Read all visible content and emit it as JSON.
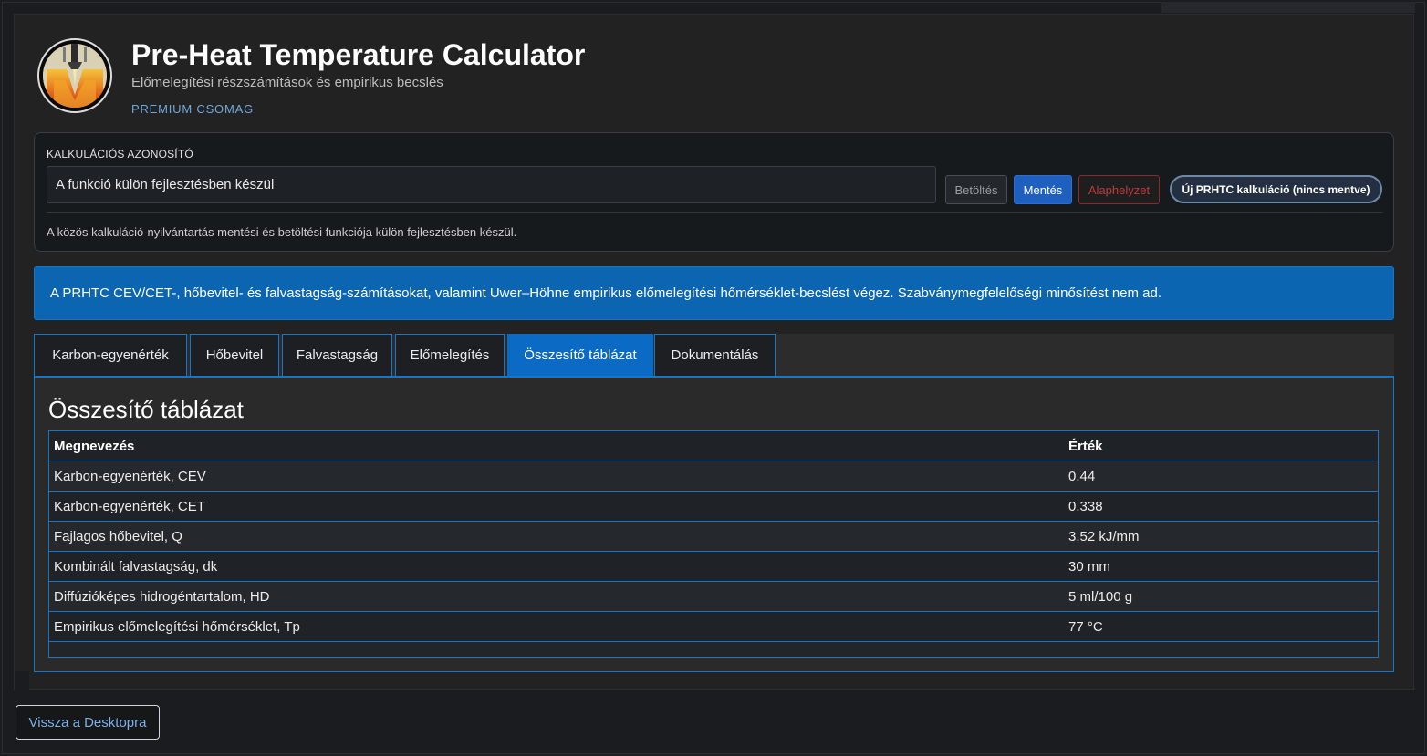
{
  "header": {
    "title": "Pre-Heat Temperature Calculator",
    "subtitle": "Előmelegítési részszámítások és empirikus becslés",
    "badge": "PREMIUM CSOMAG"
  },
  "calc": {
    "label": "KALKULÁCIÓS AZONOSÍTÓ",
    "input_value": "A funkció külön fejlesztésben készül",
    "load_label": "Betöltés",
    "save_label": "Mentés",
    "reset_label": "Alaphelyzet",
    "new_label": "Új PRHTC kalkuláció (nincs mentve)",
    "note": "A közös kalkuláció-nyilvántartás mentési és betöltési funkciója külön fejlesztésben készül."
  },
  "info": {
    "text": "A PRHTC CEV/CET-, hőbevitel- és falvastagság-számításokat, valamint Uwer–Höhne empirikus előmelegítési hőmérséklet-becslést végez. Szabványmegfelelőségi minősítést nem ad."
  },
  "tabs": [
    {
      "label": "Karbon-egyenérték"
    },
    {
      "label": "Hőbevitel"
    },
    {
      "label": "Falvastagság"
    },
    {
      "label": "Előmelegítés"
    },
    {
      "label": "Összesítő táblázat"
    },
    {
      "label": "Dokumentálás"
    }
  ],
  "active_tab": "Összesítő táblázat",
  "panel": {
    "title": "Összesítő táblázat"
  },
  "table": {
    "headers": [
      "Megnevezés",
      "Érték"
    ],
    "rows": [
      {
        "name": "Karbon-egyenérték, CEV",
        "value": "0.44"
      },
      {
        "name": "Karbon-egyenérték, CET",
        "value": "0.338"
      },
      {
        "name": "Fajlagos hőbevitel, Q",
        "value": "3.52 kJ/mm"
      },
      {
        "name": "Kombinált falvastagság, dk",
        "value": "30 mm"
      },
      {
        "name": "Diffúzióképes hidrogéntartalom, HD",
        "value": "5 ml/100 g"
      },
      {
        "name": "Empirikus előmelegítési hőmérséklet, Tp",
        "value": "77 °C"
      }
    ]
  },
  "footer": {
    "back_label": "Vissza a Desktopra"
  },
  "colors": {
    "accent": "#0b6bc4",
    "info_bg": "#0b65b0",
    "danger": "#c0393d",
    "link": "#6fa8dc"
  }
}
